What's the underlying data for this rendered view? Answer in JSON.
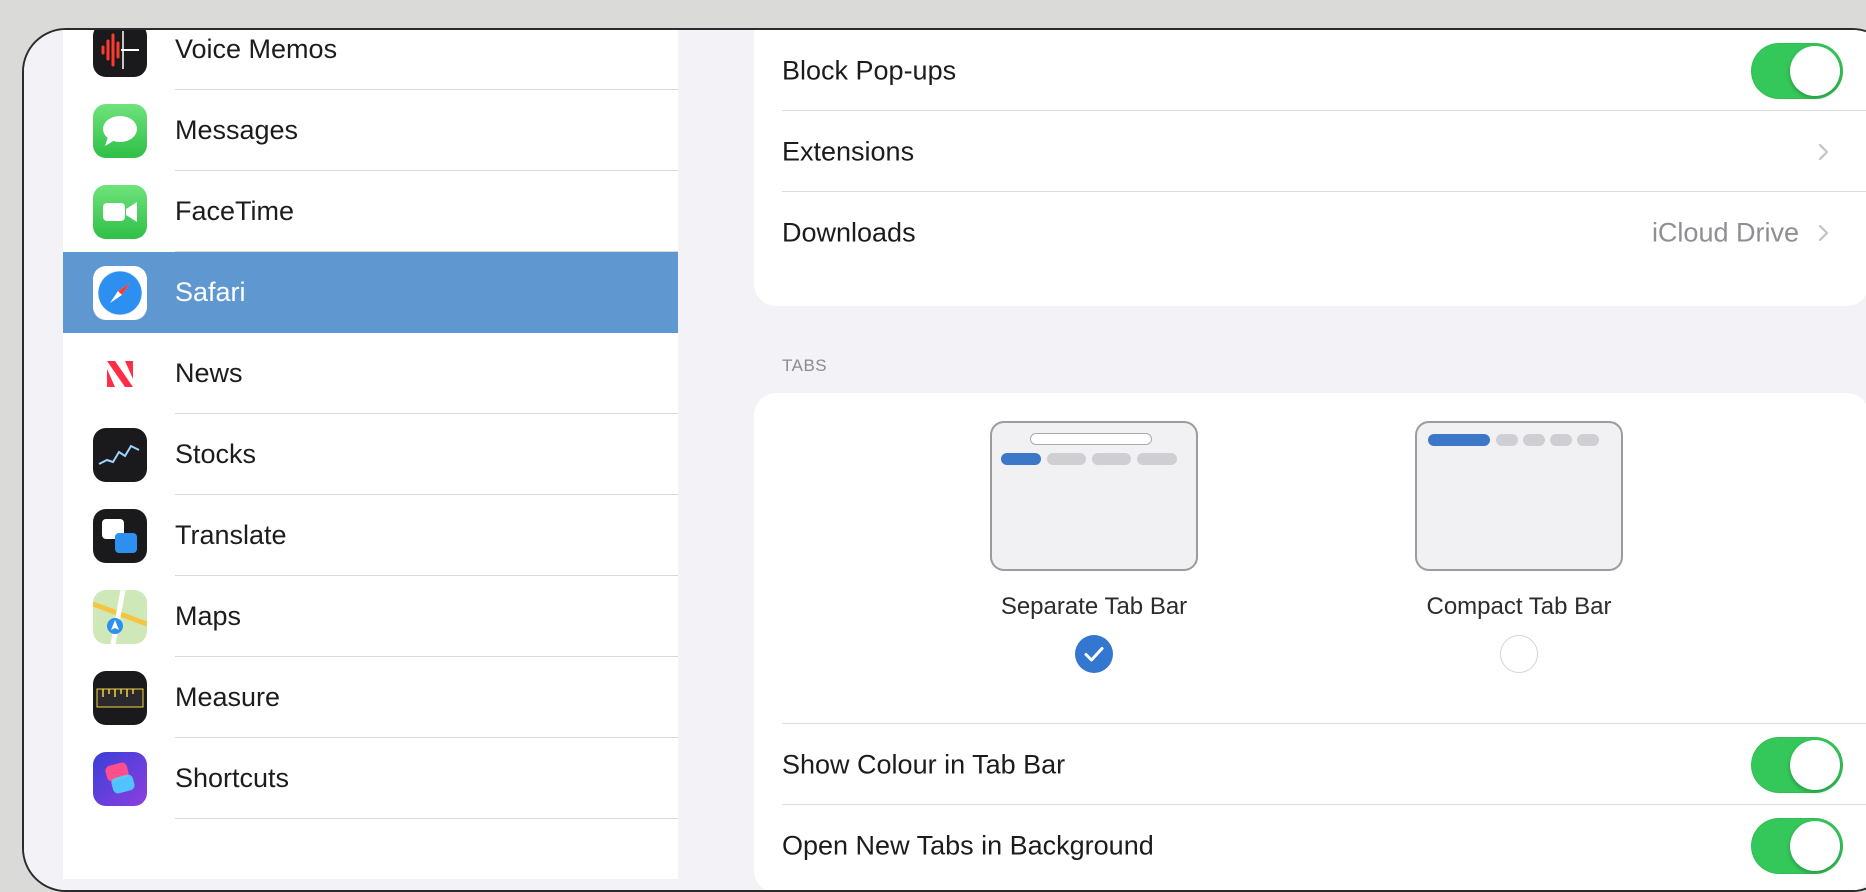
{
  "sidebar": {
    "items": [
      {
        "label": "Voice Memos",
        "icon": "voice-memos-icon"
      },
      {
        "label": "Messages",
        "icon": "messages-icon"
      },
      {
        "label": "FaceTime",
        "icon": "facetime-icon"
      },
      {
        "label": "Safari",
        "icon": "safari-icon",
        "selected": true
      },
      {
        "label": "News",
        "icon": "news-icon"
      },
      {
        "label": "Stocks",
        "icon": "stocks-icon"
      },
      {
        "label": "Translate",
        "icon": "translate-icon"
      },
      {
        "label": "Maps",
        "icon": "maps-icon"
      },
      {
        "label": "Measure",
        "icon": "measure-icon"
      },
      {
        "label": "Shortcuts",
        "icon": "shortcuts-icon"
      }
    ]
  },
  "general": {
    "block_popups": {
      "label": "Block Pop-ups",
      "on": true
    },
    "extensions": {
      "label": "Extensions"
    },
    "downloads": {
      "label": "Downloads",
      "value": "iCloud Drive"
    }
  },
  "tabs_section": {
    "header": "TABS",
    "options": [
      {
        "label": "Separate Tab Bar",
        "selected": true
      },
      {
        "label": "Compact Tab Bar",
        "selected": false
      }
    ],
    "show_colour": {
      "label": "Show Colour in Tab Bar",
      "on": true
    },
    "open_background": {
      "label": "Open New Tabs in Background",
      "on": true
    }
  },
  "colors": {
    "selection": "#5f98d0",
    "toggle_on": "#34c759",
    "accent": "#3477d0"
  }
}
